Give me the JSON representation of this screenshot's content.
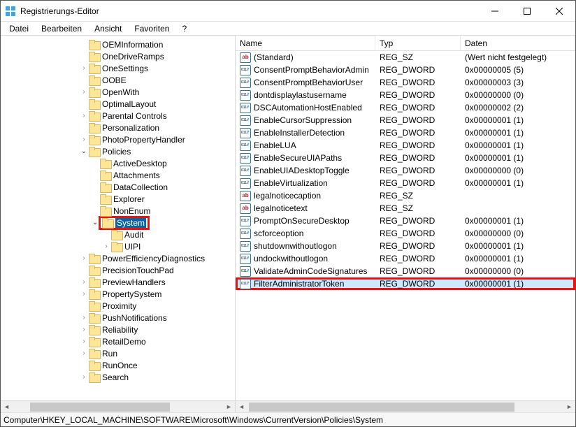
{
  "window": {
    "title": "Registrierungs-Editor"
  },
  "menu": {
    "file": "Datei",
    "edit": "Bearbeiten",
    "view": "Ansicht",
    "favorites": "Favoriten",
    "help": "?"
  },
  "tree": [
    {
      "indent": 7,
      "exp": "",
      "label": "OEMInformation"
    },
    {
      "indent": 7,
      "exp": "",
      "label": "OneDriveRamps"
    },
    {
      "indent": 7,
      "exp": ">",
      "label": "OneSettings"
    },
    {
      "indent": 7,
      "exp": "",
      "label": "OOBE"
    },
    {
      "indent": 7,
      "exp": ">",
      "label": "OpenWith"
    },
    {
      "indent": 7,
      "exp": "",
      "label": "OptimalLayout"
    },
    {
      "indent": 7,
      "exp": ">",
      "label": "Parental Controls"
    },
    {
      "indent": 7,
      "exp": "",
      "label": "Personalization"
    },
    {
      "indent": 7,
      "exp": ">",
      "label": "PhotoPropertyHandler"
    },
    {
      "indent": 7,
      "exp": "v",
      "label": "Policies"
    },
    {
      "indent": 8,
      "exp": "",
      "label": "ActiveDesktop"
    },
    {
      "indent": 8,
      "exp": "",
      "label": "Attachments"
    },
    {
      "indent": 8,
      "exp": "",
      "label": "DataCollection"
    },
    {
      "indent": 8,
      "exp": "",
      "label": "Explorer"
    },
    {
      "indent": 8,
      "exp": "",
      "label": "NonEnum"
    },
    {
      "indent": 8,
      "exp": "v",
      "label": "System",
      "selected": true,
      "redbox": true
    },
    {
      "indent": 9,
      "exp": "",
      "label": "Audit"
    },
    {
      "indent": 9,
      "exp": ">",
      "label": "UIPI"
    },
    {
      "indent": 7,
      "exp": ">",
      "label": "PowerEfficiencyDiagnostics"
    },
    {
      "indent": 7,
      "exp": "",
      "label": "PrecisionTouchPad"
    },
    {
      "indent": 7,
      "exp": ">",
      "label": "PreviewHandlers"
    },
    {
      "indent": 7,
      "exp": ">",
      "label": "PropertySystem"
    },
    {
      "indent": 7,
      "exp": "",
      "label": "Proximity"
    },
    {
      "indent": 7,
      "exp": ">",
      "label": "PushNotifications"
    },
    {
      "indent": 7,
      "exp": ">",
      "label": "Reliability"
    },
    {
      "indent": 7,
      "exp": ">",
      "label": "RetailDemo"
    },
    {
      "indent": 7,
      "exp": ">",
      "label": "Run"
    },
    {
      "indent": 7,
      "exp": "",
      "label": "RunOnce"
    },
    {
      "indent": 7,
      "exp": ">",
      "label": "Search"
    }
  ],
  "columns": {
    "name": "Name",
    "type": "Typ",
    "data": "Daten"
  },
  "values": [
    {
      "icon": "str",
      "name": "(Standard)",
      "type": "REG_SZ",
      "data": "(Wert nicht festgelegt)"
    },
    {
      "icon": "num",
      "name": "ConsentPromptBehaviorAdmin",
      "type": "REG_DWORD",
      "data": "0x00000005 (5)"
    },
    {
      "icon": "num",
      "name": "ConsentPromptBehaviorUser",
      "type": "REG_DWORD",
      "data": "0x00000003 (3)"
    },
    {
      "icon": "num",
      "name": "dontdisplaylastusername",
      "type": "REG_DWORD",
      "data": "0x00000000 (0)"
    },
    {
      "icon": "num",
      "name": "DSCAutomationHostEnabled",
      "type": "REG_DWORD",
      "data": "0x00000002 (2)"
    },
    {
      "icon": "num",
      "name": "EnableCursorSuppression",
      "type": "REG_DWORD",
      "data": "0x00000001 (1)"
    },
    {
      "icon": "num",
      "name": "EnableInstallerDetection",
      "type": "REG_DWORD",
      "data": "0x00000001 (1)"
    },
    {
      "icon": "num",
      "name": "EnableLUA",
      "type": "REG_DWORD",
      "data": "0x00000001 (1)"
    },
    {
      "icon": "num",
      "name": "EnableSecureUIAPaths",
      "type": "REG_DWORD",
      "data": "0x00000001 (1)"
    },
    {
      "icon": "num",
      "name": "EnableUIADesktopToggle",
      "type": "REG_DWORD",
      "data": "0x00000000 (0)"
    },
    {
      "icon": "num",
      "name": "EnableVirtualization",
      "type": "REG_DWORD",
      "data": "0x00000001 (1)"
    },
    {
      "icon": "str",
      "name": "legalnoticecaption",
      "type": "REG_SZ",
      "data": ""
    },
    {
      "icon": "str",
      "name": "legalnoticetext",
      "type": "REG_SZ",
      "data": ""
    },
    {
      "icon": "num",
      "name": "PromptOnSecureDesktop",
      "type": "REG_DWORD",
      "data": "0x00000001 (1)"
    },
    {
      "icon": "num",
      "name": "scforceoption",
      "type": "REG_DWORD",
      "data": "0x00000000 (0)"
    },
    {
      "icon": "num",
      "name": "shutdownwithoutlogon",
      "type": "REG_DWORD",
      "data": "0x00000001 (1)"
    },
    {
      "icon": "num",
      "name": "undockwithoutlogon",
      "type": "REG_DWORD",
      "data": "0x00000001 (1)"
    },
    {
      "icon": "num",
      "name": "ValidateAdminCodeSignatures",
      "type": "REG_DWORD",
      "data": "0x00000000 (0)"
    },
    {
      "icon": "num",
      "name": "FilterAdministratorToken",
      "type": "REG_DWORD",
      "data": "0x00000001 (1)",
      "selected": true,
      "redbox": true
    }
  ],
  "statusbar": {
    "path": "Computer\\HKEY_LOCAL_MACHINE\\SOFTWARE\\Microsoft\\Windows\\CurrentVersion\\Policies\\System"
  }
}
